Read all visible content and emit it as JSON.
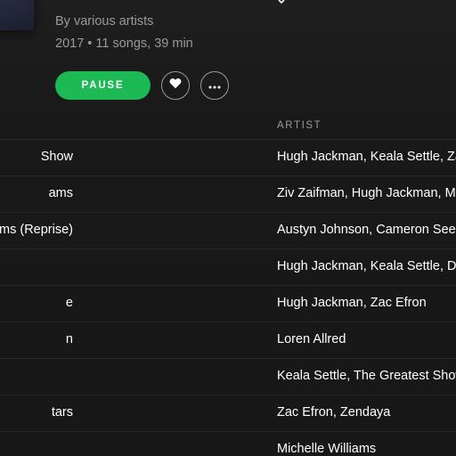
{
  "album": {
    "byline": "By various artists",
    "meta": "2017 • 11 songs, 39 min"
  },
  "actions": {
    "pause_label": "PAUSE",
    "like_icon": "heart-icon",
    "more_icon": "ellipsis-icon"
  },
  "colors": {
    "accent": "#1db954",
    "background": "#181818",
    "text_primary": "#ffffff",
    "text_secondary": "#9a9a9a"
  },
  "table": {
    "artist_header": "ARTIST",
    "rows": [
      {
        "title": "Show",
        "artist": "Hugh Jackman, Keala Settle, Za"
      },
      {
        "title": "ams",
        "artist": "Ziv Zaifman, Hugh Jackman, M"
      },
      {
        "title": "ams (Reprise)",
        "artist": "Austyn Johnson, Cameron Seel"
      },
      {
        "title": "",
        "artist": "Hugh Jackman, Keala Settle, D"
      },
      {
        "title": "e",
        "artist": "Hugh Jackman, Zac Efron"
      },
      {
        "title": "n",
        "artist": "Loren Allred"
      },
      {
        "title": "",
        "artist": "Keala Settle, The Greatest Show"
      },
      {
        "title": "tars",
        "artist": "Zac Efron, Zendaya"
      },
      {
        "title": "",
        "artist": "Michelle Williams"
      }
    ]
  }
}
